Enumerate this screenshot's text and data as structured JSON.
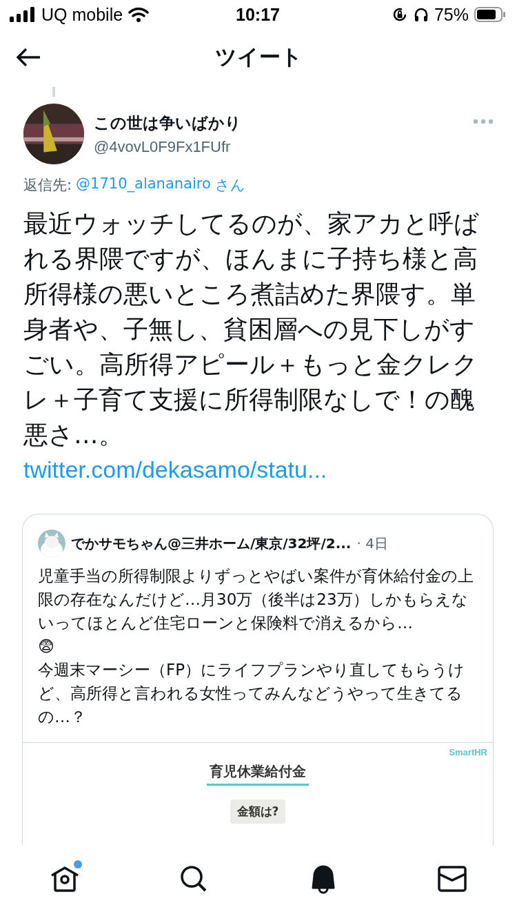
{
  "status_bar": {
    "carrier": "UQ mobile",
    "time": "10:17",
    "battery": "75%"
  },
  "header": {
    "title": "ツイート"
  },
  "tweet": {
    "name": "この世は争いばかり",
    "handle": "@4vovL0F9Fx1FUfr",
    "reply_prefix": "返信先:",
    "reply_to": "@1710_alananairo",
    "reply_suffix": "さん",
    "text": "最近ウォッチしてるのが、家アカと呼ばれる界隈ですが、ほんまに子持ち様と高所得様の悪いところ煮詰めた界隈す。単身者や、子無し、貧困層への見下しがすごい。高所得アピール＋もっと金クレクレ＋子育て支援に所得制限なしで！の醜悪さ…。",
    "link": "twitter.com/dekasamo/statu...",
    "quote": {
      "name": "でかサモちゃん@三井ホーム/東京/32坪/2...",
      "time": "· 4日",
      "text": "児童手当の所得制限よりずっとやばい案件が育休給付金の上限の存在なんだけど…月30万（後半は23万）しかもらえないってほとんど住宅ローンと保険料で消えるから…\n😨\n今週末マーシー（FP）にライフプランやり直してもらうけど、高所得と言われる女性ってみんなどうやって生きてるの…？",
      "media": {
        "brand": "SmartHR",
        "title": "育児休業給付金",
        "label": "金額は?"
      }
    }
  },
  "tab_bar": [
    {
      "kind": "home",
      "badge": true
    },
    {
      "kind": "search",
      "badge": false
    },
    {
      "kind": "bell",
      "badge": false
    },
    {
      "kind": "mail",
      "badge": false
    }
  ]
}
